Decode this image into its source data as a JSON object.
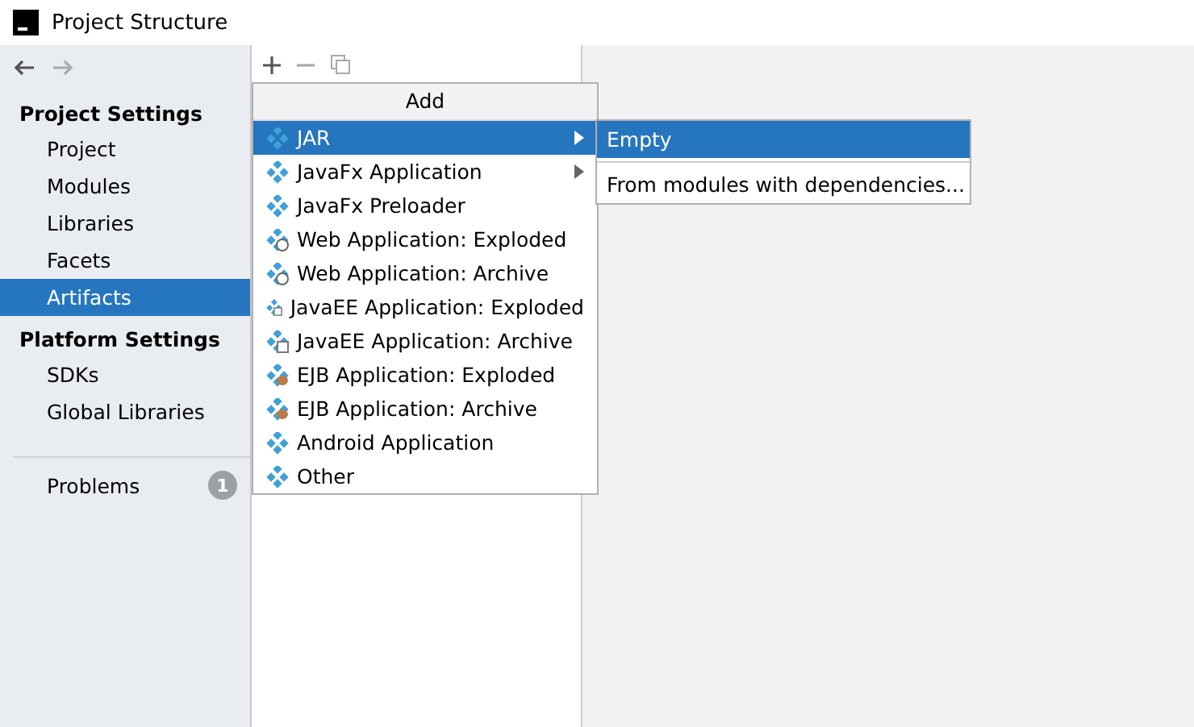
{
  "window": {
    "title": "Project Structure"
  },
  "sidebar": {
    "sections": [
      {
        "heading": "Project Settings",
        "items": [
          {
            "label": "Project",
            "selected": false
          },
          {
            "label": "Modules",
            "selected": false
          },
          {
            "label": "Libraries",
            "selected": false
          },
          {
            "label": "Facets",
            "selected": false
          },
          {
            "label": "Artifacts",
            "selected": true
          }
        ]
      },
      {
        "heading": "Platform Settings",
        "items": [
          {
            "label": "SDKs",
            "selected": false
          },
          {
            "label": "Global Libraries",
            "selected": false
          }
        ]
      }
    ],
    "problems": {
      "label": "Problems",
      "count": "1"
    }
  },
  "add_menu": {
    "title": "Add",
    "items": [
      {
        "label": "JAR",
        "kind": "jar",
        "selected": true,
        "has_submenu": true
      },
      {
        "label": "JavaFx Application",
        "kind": "jar",
        "selected": false,
        "has_submenu": true
      },
      {
        "label": "JavaFx Preloader",
        "kind": "jar",
        "selected": false,
        "has_submenu": false
      },
      {
        "label": "Web Application: Exploded",
        "kind": "web",
        "selected": false,
        "has_submenu": false
      },
      {
        "label": "Web Application: Archive",
        "kind": "web",
        "selected": false,
        "has_submenu": false
      },
      {
        "label": "JavaEE Application: Exploded",
        "kind": "javaee",
        "selected": false,
        "has_submenu": false
      },
      {
        "label": "JavaEE Application: Archive",
        "kind": "javaee",
        "selected": false,
        "has_submenu": false
      },
      {
        "label": "EJB Application: Exploded",
        "kind": "ejb",
        "selected": false,
        "has_submenu": false
      },
      {
        "label": "EJB Application: Archive",
        "kind": "ejb",
        "selected": false,
        "has_submenu": false
      },
      {
        "label": "Android Application",
        "kind": "jar",
        "selected": false,
        "has_submenu": false
      },
      {
        "label": "Other",
        "kind": "jar",
        "selected": false,
        "has_submenu": false
      }
    ]
  },
  "jar_submenu": {
    "items": [
      {
        "label": "Empty",
        "selected": true
      },
      {
        "label": "From modules with dependencies...",
        "selected": false
      }
    ]
  }
}
